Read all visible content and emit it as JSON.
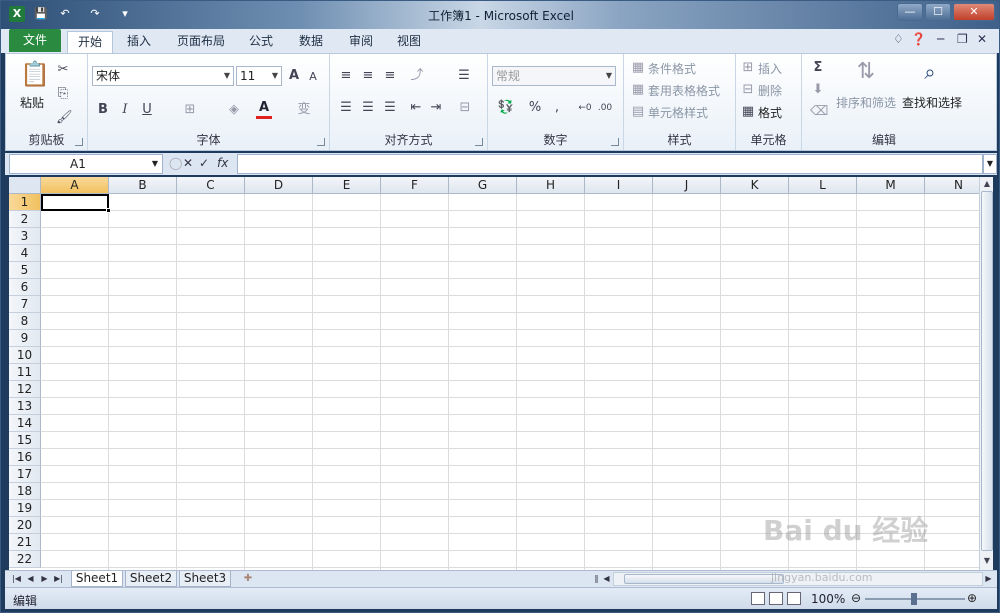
{
  "window": {
    "title": "工作簿1 - Microsoft Excel",
    "app_icon": "X",
    "minimize": "—",
    "maximize": "☐",
    "close": "✕"
  },
  "tabs": {
    "file": "文件",
    "items": [
      "开始",
      "插入",
      "页面布局",
      "公式",
      "数据",
      "审阅",
      "视图"
    ],
    "active": "开始"
  },
  "ribbon": {
    "clipboard": {
      "paste": "粘贴",
      "label": "剪贴板"
    },
    "font": {
      "name": "宋体",
      "size": "11",
      "bold": "B",
      "italic": "I",
      "underline": "U",
      "label": "字体"
    },
    "alignment": {
      "label": "对齐方式"
    },
    "number": {
      "format": "常规",
      "percent": "%",
      "comma": ",",
      "label": "数字"
    },
    "styles": {
      "conditional": "条件格式",
      "table": "套用表格格式",
      "cell": "单元格样式",
      "label": "样式"
    },
    "cells": {
      "insert": "插入",
      "delete": "删除",
      "format": "格式",
      "label": "单元格"
    },
    "editing": {
      "sum": "Σ",
      "sort": "排序和筛选",
      "find": "查找和选择",
      "label": "编辑"
    }
  },
  "formula_bar": {
    "name_box": "A1",
    "fx": "fx",
    "value": ""
  },
  "sheet": {
    "columns": [
      "A",
      "B",
      "C",
      "D",
      "E",
      "F",
      "G",
      "H",
      "I",
      "J",
      "K",
      "L",
      "M",
      "N"
    ],
    "rows": [
      "1",
      "2",
      "3",
      "4",
      "5",
      "6",
      "7",
      "8",
      "9",
      "10",
      "11",
      "12",
      "13",
      "14",
      "15",
      "16",
      "17",
      "18",
      "19",
      "20",
      "21",
      "22"
    ],
    "active_cell": "A1"
  },
  "sheet_tabs": [
    "Sheet1",
    "Sheet2",
    "Sheet3"
  ],
  "active_sheet": "Sheet1",
  "status": {
    "mode": "编辑",
    "zoom": "100%"
  },
  "watermark": {
    "brand": "Bai du 经验",
    "url": "jingyan.baidu.com"
  },
  "colors": {
    "file_tab": "#2a8a3f",
    "selected_header": "#f1c15f",
    "grid_line": "#dadcdd"
  }
}
